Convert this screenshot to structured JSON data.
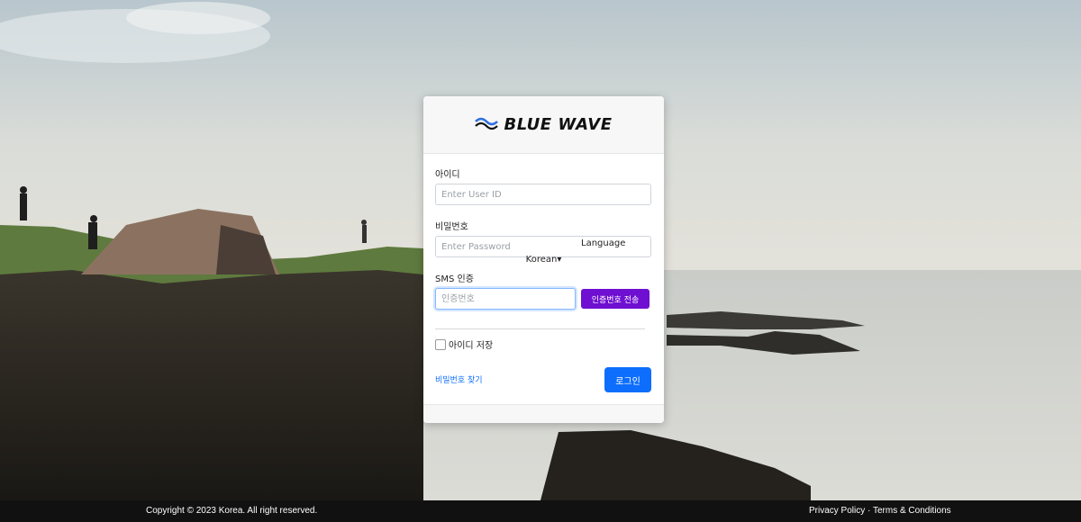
{
  "brand": {
    "name": "BLUE WAVE"
  },
  "login": {
    "userid_label": "아이디",
    "userid_placeholder": "Enter User ID",
    "password_label": "비밀번호",
    "password_placeholder": "Enter Password",
    "sms_label": "SMS 인증",
    "sms_placeholder": "인증번호",
    "sms_send_button": "인증번호 전송",
    "language_label": "Language",
    "language_selected": "Korean▾",
    "remember_label": "아이디 저장",
    "find_password_link": "비밀번호 찾기",
    "login_button": "로그인"
  },
  "footer": {
    "copyright": "Copyright © 2023 Korea. All right reserved.",
    "privacy": "Privacy Policy",
    "separator": " · ",
    "terms": "Terms & Conditions"
  },
  "colors": {
    "primary": "#0d6efd",
    "send_button": "#6f0fd1",
    "logo_wave": "#2f6fe0"
  }
}
